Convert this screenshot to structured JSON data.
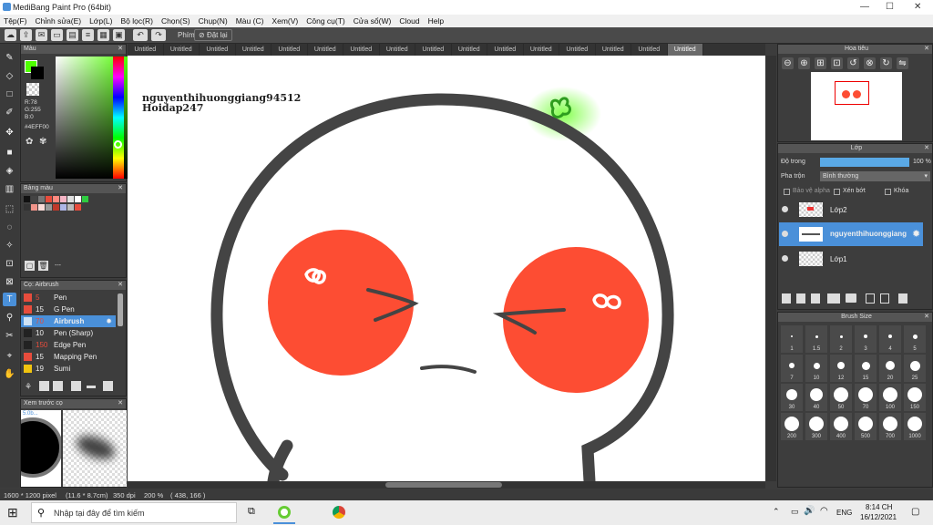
{
  "window": {
    "title": "MediBang Paint Pro (64bit)"
  },
  "menu": [
    "Tệp(F)",
    "Chỉnh sửa(E)",
    "Lớp(L)",
    "Bộ lọc(R)",
    "Chọn(S)",
    "Chụp(N)",
    "Màu (C)",
    "Xem(V)",
    "Công cụ(T)",
    "Cửa sổ(W)",
    "Cloud",
    "Help"
  ],
  "toolbar": {
    "phim_label": "Phím",
    "reset_label": "Đặt lại"
  },
  "tabs": [
    "Untitled",
    "Untitled",
    "Untitled",
    "Untitled",
    "Untitled",
    "Untitled",
    "Untitled",
    "Untitled",
    "Untitled",
    "Untitled",
    "Untitled",
    "Untitled",
    "Untitled",
    "Untitled",
    "Untitled",
    "Untitled"
  ],
  "color_panel": {
    "title": "Màu",
    "r": "R:78",
    "g": "G:255",
    "b": "B:0",
    "hex": "#4EFF00",
    "fg": "#4eff00",
    "bg": "#000000"
  },
  "palette_panel": {
    "title": "Bảng màu",
    "name": "---",
    "colors": [
      "#111111",
      "#444444",
      "#777777",
      "#e74c3c",
      "#ff8a80",
      "#f5b5c5",
      "#e0e0e0",
      "#ffffff",
      "#2ecc40",
      "#333333",
      "#f1948a",
      "#fadbd8",
      "#999999",
      "#c0392b",
      "#aeb6e6",
      "#bbbbbb",
      "#e74c3c"
    ]
  },
  "brush_panel": {
    "title": "Cọ: Airbrush",
    "brushes": [
      {
        "size": "5",
        "name": "Pen",
        "color": "#e74c3c"
      },
      {
        "size": "15",
        "name": "G Pen",
        "color": "#e74c3c"
      },
      {
        "size": "70",
        "name": "Airbrush",
        "color": "#cfe3f5"
      },
      {
        "size": "10",
        "name": "Pen (Sharp)",
        "color": "#222222"
      },
      {
        "size": "150",
        "name": "Edge Pen",
        "color": "#222222"
      },
      {
        "size": "15",
        "name": "Mapping Pen",
        "color": "#e74c3c"
      },
      {
        "size": "19",
        "name": "Sumi",
        "color": "#f1c40f"
      }
    ]
  },
  "preview_panel": {
    "title": "Xem trước cọ",
    "size_label": "5.0b..."
  },
  "canvas": {
    "watermark_line1": "nguyenthihuonggiang94512",
    "watermark_line2": "Hoidap247"
  },
  "navigator_panel": {
    "title": "Hoa tiêu"
  },
  "layer_panel": {
    "title": "Lớp",
    "opacity_label": "Độ trong",
    "opacity_value": "100 %",
    "blend_label": "Pha trộn",
    "blend_value": "Bình thường",
    "protect_alpha": "Bảo vệ alpha",
    "clipping": "Xén bớt",
    "lock": "Khóa",
    "layers": [
      "Lớp2",
      "nguyenthihuonggiang",
      "Lớp1"
    ]
  },
  "brush_size_panel": {
    "title": "Brush Size",
    "sizes": [
      "1",
      "1.5",
      "2",
      "3",
      "4",
      "5",
      "7",
      "10",
      "12",
      "15",
      "20",
      "25",
      "30",
      "40",
      "50",
      "70",
      "100",
      "150",
      "200",
      "300",
      "400",
      "500",
      "700",
      "1000"
    ]
  },
  "status": {
    "dimensions": "1600 * 1200 pixel",
    "physical": "(11.6 * 8.7cm)",
    "dpi": "350 dpi",
    "zoom": "200 %",
    "coords": "( 438, 166 )"
  },
  "taskbar": {
    "search_placeholder": "Nhập tại đây để tìm kiếm",
    "lang": "ENG",
    "time": "8:14 CH",
    "date": "16/12/2021"
  }
}
